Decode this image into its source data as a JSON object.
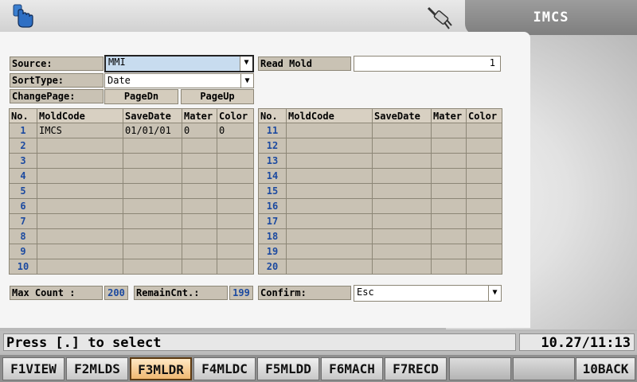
{
  "title": "IMCS",
  "form": {
    "source_label": "Source:",
    "source_value": "MMI",
    "sorttype_label": "SortType:",
    "sorttype_value": "Date",
    "changepage_label": "ChangePage:",
    "pagedn_label": "PageDn",
    "pageup_label": "PageUp",
    "readmold_label": "Read Mold",
    "readmold_value": "1"
  },
  "table": {
    "headers": [
      "No.",
      "MoldCode",
      "SaveDate",
      "Mater",
      "Color"
    ],
    "left_rows": [
      {
        "no": "1",
        "moldcode": "IMCS",
        "savedate": "01/01/01",
        "mater": "0",
        "color": "0"
      },
      {
        "no": "2",
        "moldcode": "",
        "savedate": "",
        "mater": "",
        "color": ""
      },
      {
        "no": "3",
        "moldcode": "",
        "savedate": "",
        "mater": "",
        "color": ""
      },
      {
        "no": "4",
        "moldcode": "",
        "savedate": "",
        "mater": "",
        "color": ""
      },
      {
        "no": "5",
        "moldcode": "",
        "savedate": "",
        "mater": "",
        "color": ""
      },
      {
        "no": "6",
        "moldcode": "",
        "savedate": "",
        "mater": "",
        "color": ""
      },
      {
        "no": "7",
        "moldcode": "",
        "savedate": "",
        "mater": "",
        "color": ""
      },
      {
        "no": "8",
        "moldcode": "",
        "savedate": "",
        "mater": "",
        "color": ""
      },
      {
        "no": "9",
        "moldcode": "",
        "savedate": "",
        "mater": "",
        "color": ""
      },
      {
        "no": "10",
        "moldcode": "",
        "savedate": "",
        "mater": "",
        "color": ""
      }
    ],
    "right_rows": [
      {
        "no": "11",
        "moldcode": "",
        "savedate": "",
        "mater": "",
        "color": ""
      },
      {
        "no": "12",
        "moldcode": "",
        "savedate": "",
        "mater": "",
        "color": ""
      },
      {
        "no": "13",
        "moldcode": "",
        "savedate": "",
        "mater": "",
        "color": ""
      },
      {
        "no": "14",
        "moldcode": "",
        "savedate": "",
        "mater": "",
        "color": ""
      },
      {
        "no": "15",
        "moldcode": "",
        "savedate": "",
        "mater": "",
        "color": ""
      },
      {
        "no": "16",
        "moldcode": "",
        "savedate": "",
        "mater": "",
        "color": ""
      },
      {
        "no": "17",
        "moldcode": "",
        "savedate": "",
        "mater": "",
        "color": ""
      },
      {
        "no": "18",
        "moldcode": "",
        "savedate": "",
        "mater": "",
        "color": ""
      },
      {
        "no": "19",
        "moldcode": "",
        "savedate": "",
        "mater": "",
        "color": ""
      },
      {
        "no": "20",
        "moldcode": "",
        "savedate": "",
        "mater": "",
        "color": ""
      }
    ]
  },
  "footer": {
    "maxcount_label": "Max Count :",
    "maxcount_value": "200",
    "remain_label": "RemainCnt.:",
    "remain_value": "199",
    "confirm_label": "Confirm:",
    "confirm_value": "Esc"
  },
  "status": {
    "message": "Press [.] to select",
    "datetime": "10.27/11:13"
  },
  "fkeys": [
    "F1VIEW",
    "F2MLDS",
    "F3MLDR",
    "F4MLDC",
    "F5MLDD",
    "F6MACH",
    "F7RECD",
    "",
    "",
    "10BACK"
  ],
  "active_fkey": "F3MLDR",
  "icons": [
    "hand-pointer-icon",
    "plug-icon",
    "dropdown-arrow-icon"
  ]
}
